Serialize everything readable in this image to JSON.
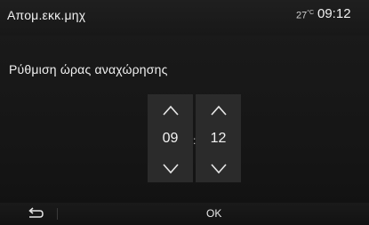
{
  "header": {
    "title": "Απομ.εκκ.μηχ",
    "temperature": "27",
    "temperature_unit": "°C",
    "time": "09:12"
  },
  "content": {
    "heading": "Ρύθμιση ώρας αναχώρησης"
  },
  "time_picker": {
    "hours": "09",
    "separator": ":",
    "minutes": "12"
  },
  "footer": {
    "ok_label": "OK"
  },
  "icons": {
    "back": "back-arrow-icon",
    "up": "chevron-up-icon",
    "down": "chevron-down-icon"
  }
}
